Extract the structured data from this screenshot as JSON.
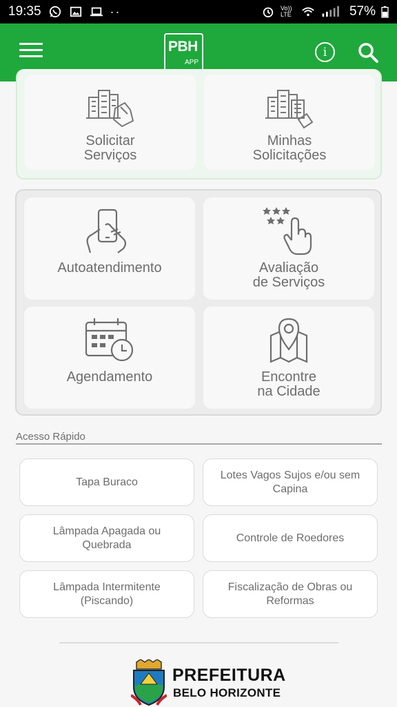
{
  "status": {
    "time": "19:35",
    "battery": "57%",
    "icons": [
      "whatsapp-icon",
      "image-icon",
      "laptop-icon",
      "more-dots-icon",
      "alarm-icon",
      "volte-icon",
      "wifi-icon",
      "signal-icon",
      "battery-icon"
    ],
    "volte_label": "Vo)) LTE"
  },
  "appbar": {
    "logo_big": "PBH",
    "logo_small": "APP",
    "info_icon": "i",
    "bg_color": "#1fa83c"
  },
  "services": [
    {
      "label": "Solicitar\nServiços",
      "icon": "buildings-hand-icon"
    },
    {
      "label": "Minhas\nSolicitações",
      "icon": "buildings-list-icon"
    }
  ],
  "tools": [
    {
      "label": "Autoatendimento",
      "icon": "phone-touch-icon"
    },
    {
      "label": "Avaliação\nde Serviços",
      "icon": "stars-tap-icon"
    },
    {
      "label": "Agendamento",
      "icon": "calendar-clock-icon"
    },
    {
      "label": "Encontre\nna Cidade",
      "icon": "map-pin-icon"
    }
  ],
  "quick_access": {
    "title": "Acesso Rápido",
    "items": [
      "Tapa Buraco",
      "Lotes Vagos Sujos e/ou sem Capina",
      "Lâmpada Apagada ou Quebrada",
      "Controle de Roedores",
      "Lâmpada Intermitente (Piscando)",
      "Fiscalização de Obras ou Reformas"
    ]
  },
  "footer": {
    "brand_line1": "PREFEITURA",
    "brand_line2": "BELO HORIZONTE"
  }
}
